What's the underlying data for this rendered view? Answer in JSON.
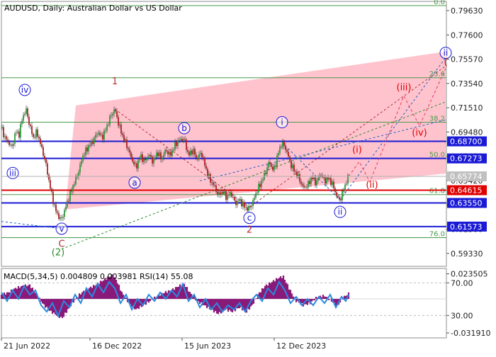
{
  "chart_data": [
    {
      "type": "line",
      "title": "AUDUSD, Daily:  Australian Dollar vs US Dollar",
      "ylim": [
        0.5825,
        0.804
      ],
      "y_ticks": [
        "0.79630",
        "0.77600",
        "0.75570",
        "0.73540",
        "0.71510",
        "0.69480",
        "0.67450",
        "0.65420",
        "0.63390",
        "0.61360",
        "0.59330"
      ],
      "x_ticks": [
        {
          "label": "21 Jun 2022",
          "bar": 0
        },
        {
          "label": "16 Dec 2022",
          "bar": 125
        },
        {
          "label": "15 Jun 2023",
          "bar": 255
        },
        {
          "label": "12 Dec 2023",
          "bar": 385
        }
      ],
      "price_tags": [
        {
          "value": 0.687,
          "label": "0.68700",
          "color": "#1a1ad6"
        },
        {
          "value": 0.67273,
          "label": "0.67273",
          "color": "#1a1ad6"
        },
        {
          "value": 0.65774,
          "label": "0.65774",
          "color": "#c0c0c0"
        },
        {
          "value": 0.64615,
          "label": "0.64615",
          "color": "#e00000"
        },
        {
          "value": 0.6355,
          "label": "0.63550",
          "color": "#1a1ad6"
        },
        {
          "value": 0.61573,
          "label": "0.61573",
          "color": "#1a1ad6"
        }
      ],
      "fib_levels": [
        {
          "label": "0.0",
          "value": 0.8005
        },
        {
          "label": "23.6",
          "value": 0.7402
        },
        {
          "label": "38.2",
          "value": 0.703
        },
        {
          "label": "50.0",
          "value": 0.6727
        },
        {
          "label": "61.8",
          "value": 0.6425
        },
        {
          "label": "76.0",
          "value": 0.6065
        }
      ],
      "wave_labels": [
        {
          "text": "iv",
          "bar": 33,
          "value": 0.73,
          "color": "#1a1ad6",
          "circled": true
        },
        {
          "text": "iii",
          "bar": 16,
          "value": 0.6605,
          "color": "#1a1ad6",
          "circled": true
        },
        {
          "text": "v",
          "bar": 85,
          "value": 0.614,
          "color": "#1a1ad6",
          "circled": true
        },
        {
          "text": "C",
          "bar": 85,
          "value": 0.6012,
          "color": "#b03030",
          "circled": false
        },
        {
          "text": "(2)",
          "bar": 80,
          "value": 0.594,
          "color": "#2a8a2a",
          "circled": false
        },
        {
          "text": "1",
          "bar": 160,
          "value": 0.737,
          "color": "#b03030",
          "circled": false
        },
        {
          "text": "a",
          "bar": 188,
          "value": 0.6525,
          "color": "#1a1ad6",
          "circled": true
        },
        {
          "text": "b",
          "bar": 258,
          "value": 0.698,
          "color": "#1a1ad6",
          "circled": true
        },
        {
          "text": "c",
          "bar": 350,
          "value": 0.623,
          "color": "#1a1ad6",
          "circled": true
        },
        {
          "text": "2",
          "bar": 350,
          "value": 0.613,
          "color": "#b03030",
          "circled": false
        },
        {
          "text": "i",
          "bar": 396,
          "value": 0.703,
          "color": "#1a1ad6",
          "circled": true
        },
        {
          "text": "ii",
          "bar": 478,
          "value": 0.628,
          "color": "#1a1ad6",
          "circled": true
        },
        {
          "text": "(i)",
          "bar": 502,
          "value": 0.68,
          "color": "#e00000",
          "circled": false
        },
        {
          "text": "(ii)",
          "bar": 523,
          "value": 0.6505,
          "color": "#e00000",
          "circled": false
        },
        {
          "text": "(iii)",
          "bar": 568,
          "value": 0.732,
          "color": "#e00000",
          "circled": false
        },
        {
          "text": "(iv)",
          "bar": 590,
          "value": 0.694,
          "color": "#e00000",
          "circled": false
        },
        {
          "text": "ii",
          "bar": 627,
          "value": 0.761,
          "color": "#1a1ad6",
          "circled": true
        },
        {
          "text": "(",
          "bar": 627,
          "value": 0.753,
          "color": "#e00000",
          "circled": false
        }
      ],
      "price_path": [
        [
          0,
          0.698
        ],
        [
          5,
          0.69
        ],
        [
          10,
          0.686
        ],
        [
          15,
          0.682
        ],
        [
          20,
          0.695
        ],
        [
          25,
          0.693
        ],
        [
          30,
          0.708
        ],
        [
          35,
          0.713
        ],
        [
          40,
          0.7
        ],
        [
          45,
          0.69
        ],
        [
          50,
          0.695
        ],
        [
          55,
          0.685
        ],
        [
          62,
          0.67
        ],
        [
          70,
          0.645
        ],
        [
          76,
          0.63
        ],
        [
          80,
          0.625
        ],
        [
          84,
          0.621
        ],
        [
          88,
          0.627
        ],
        [
          94,
          0.638
        ],
        [
          100,
          0.648
        ],
        [
          108,
          0.66
        ],
        [
          115,
          0.675
        ],
        [
          122,
          0.682
        ],
        [
          130,
          0.688
        ],
        [
          136,
          0.695
        ],
        [
          142,
          0.69
        ],
        [
          148,
          0.698
        ],
        [
          154,
          0.708
        ],
        [
          160,
          0.714
        ],
        [
          166,
          0.7
        ],
        [
          172,
          0.69
        ],
        [
          178,
          0.682
        ],
        [
          184,
          0.672
        ],
        [
          190,
          0.665
        ],
        [
          196,
          0.675
        ],
        [
          202,
          0.67
        ],
        [
          208,
          0.676
        ],
        [
          214,
          0.67
        ],
        [
          220,
          0.678
        ],
        [
          226,
          0.672
        ],
        [
          232,
          0.68
        ],
        [
          238,
          0.675
        ],
        [
          244,
          0.683
        ],
        [
          250,
          0.688
        ],
        [
          258,
          0.689
        ],
        [
          264,
          0.675
        ],
        [
          270,
          0.68
        ],
        [
          276,
          0.672
        ],
        [
          282,
          0.678
        ],
        [
          288,
          0.665
        ],
        [
          294,
          0.655
        ],
        [
          300,
          0.65
        ],
        [
          306,
          0.642
        ],
        [
          312,
          0.645
        ],
        [
          318,
          0.64
        ],
        [
          324,
          0.644
        ],
        [
          330,
          0.635
        ],
        [
          336,
          0.638
        ],
        [
          342,
          0.633
        ],
        [
          348,
          0.63
        ],
        [
          354,
          0.635
        ],
        [
          360,
          0.645
        ],
        [
          366,
          0.652
        ],
        [
          372,
          0.66
        ],
        [
          378,
          0.67
        ],
        [
          384,
          0.662
        ],
        [
          390,
          0.676
        ],
        [
          396,
          0.686
        ],
        [
          402,
          0.68
        ],
        [
          408,
          0.668
        ],
        [
          414,
          0.662
        ],
        [
          420,
          0.656
        ],
        [
          426,
          0.648
        ],
        [
          432,
          0.65
        ],
        [
          438,
          0.657
        ],
        [
          444,
          0.652
        ],
        [
          450,
          0.66
        ],
        [
          456,
          0.654
        ],
        [
          462,
          0.656
        ],
        [
          468,
          0.65
        ],
        [
          474,
          0.64
        ],
        [
          478,
          0.638
        ],
        [
          482,
          0.645
        ],
        [
          486,
          0.652
        ],
        [
          490,
          0.6577
        ]
      ],
      "channel": {
        "upper": [
          [
            105,
            0.717
          ],
          [
            627,
            0.762
          ]
        ],
        "lower": [
          [
            90,
            0.63
          ],
          [
            627,
            0.66
          ]
        ]
      },
      "forecast_path": [
        [
          490,
          0.6577
        ],
        [
          505,
          0.67
        ],
        [
          520,
          0.653
        ],
        [
          568,
          0.725
        ],
        [
          590,
          0.7
        ],
        [
          627,
          0.748
        ]
      ],
      "trend_lines": [
        {
          "from": [
            0,
            0.62
          ],
          "to": [
            85,
            0.614
          ],
          "style": "dashed",
          "color": "#2060c0"
        },
        {
          "from": [
            85,
            0.597
          ],
          "to": [
            627,
            0.72
          ],
          "style": "dashed",
          "color": "#2a8a2a"
        },
        {
          "from": [
            160,
            0.714
          ],
          "to": [
            350,
            0.632
          ],
          "style": "dashed",
          "color": "#b03030"
        },
        {
          "from": [
            350,
            0.632
          ],
          "to": [
            627,
            0.75
          ],
          "style": "dashed",
          "color": "#b03030"
        },
        {
          "from": [
            396,
            0.686
          ],
          "to": [
            478,
            0.638
          ],
          "style": "dashed",
          "color": "#2060c0"
        },
        {
          "from": [
            478,
            0.638
          ],
          "to": [
            627,
            0.757
          ],
          "style": "dashed",
          "color": "#2060c0"
        },
        {
          "from": [
            280,
            0.654
          ],
          "to": [
            627,
            0.705
          ],
          "style": "dashed",
          "color": "#2060c0"
        }
      ]
    },
    {
      "type": "area",
      "title": "MACD(5,34,5) 0.004809 0.003981 RSI(14) 55.08",
      "ylim": [
        -0.0365,
        0.0285
      ],
      "y_ticks": [
        "0.023505",
        "70.00",
        "30.00",
        "-0.031910"
      ],
      "levels": [
        {
          "label": "70.00",
          "value": 0.015
        },
        {
          "label": "30.00",
          "value": -0.0155
        }
      ],
      "histogram": [
        [
          0,
          0.004
        ],
        [
          10,
          0.006
        ],
        [
          20,
          0.01
        ],
        [
          30,
          0.012
        ],
        [
          40,
          0.013
        ],
        [
          50,
          0.004
        ],
        [
          60,
          -0.006
        ],
        [
          70,
          -0.012
        ],
        [
          80,
          -0.016
        ],
        [
          86,
          -0.018
        ],
        [
          92,
          -0.012
        ],
        [
          100,
          -0.004
        ],
        [
          110,
          0.004
        ],
        [
          120,
          0.009
        ],
        [
          130,
          0.012
        ],
        [
          140,
          0.016
        ],
        [
          150,
          0.02
        ],
        [
          156,
          0.022
        ],
        [
          162,
          0.018
        ],
        [
          170,
          0.006
        ],
        [
          180,
          -0.004
        ],
        [
          190,
          -0.01
        ],
        [
          200,
          -0.006
        ],
        [
          210,
          -0.002
        ],
        [
          220,
          0.003
        ],
        [
          230,
          0.006
        ],
        [
          240,
          0.008
        ],
        [
          250,
          0.012
        ],
        [
          258,
          0.014
        ],
        [
          266,
          0.006
        ],
        [
          276,
          -0.002
        ],
        [
          286,
          -0.006
        ],
        [
          296,
          -0.01
        ],
        [
          306,
          -0.014
        ],
        [
          316,
          -0.01
        ],
        [
          326,
          -0.012
        ],
        [
          336,
          -0.008
        ],
        [
          346,
          -0.012
        ],
        [
          354,
          -0.006
        ],
        [
          362,
          0.004
        ],
        [
          372,
          0.012
        ],
        [
          382,
          0.016
        ],
        [
          392,
          0.02
        ],
        [
          398,
          0.021
        ],
        [
          406,
          0.01
        ],
        [
          416,
          -0.002
        ],
        [
          426,
          -0.006
        ],
        [
          436,
          -0.004
        ],
        [
          446,
          0.002
        ],
        [
          456,
          0.003
        ],
        [
          466,
          -0.002
        ],
        [
          474,
          -0.007
        ],
        [
          482,
          0.001
        ],
        [
          490,
          0.005
        ]
      ],
      "rsi_line": [
        [
          0,
          0.006
        ],
        [
          8,
          -0.002
        ],
        [
          16,
          0.008
        ],
        [
          24,
          0.0
        ],
        [
          32,
          0.012
        ],
        [
          40,
          0.004
        ],
        [
          48,
          0.008
        ],
        [
          56,
          -0.006
        ],
        [
          64,
          -0.012
        ],
        [
          72,
          -0.004
        ],
        [
          80,
          -0.016
        ],
        [
          88,
          -0.002
        ],
        [
          96,
          -0.008
        ],
        [
          104,
          0.004
        ],
        [
          112,
          -0.004
        ],
        [
          120,
          0.01
        ],
        [
          128,
          0.002
        ],
        [
          136,
          0.014
        ],
        [
          144,
          0.006
        ],
        [
          152,
          0.016
        ],
        [
          160,
          0.01
        ],
        [
          168,
          -0.004
        ],
        [
          176,
          0.004
        ],
        [
          184,
          -0.01
        ],
        [
          192,
          0.0
        ],
        [
          200,
          -0.006
        ],
        [
          208,
          0.004
        ],
        [
          216,
          -0.002
        ],
        [
          224,
          0.006
        ],
        [
          232,
          0.0
        ],
        [
          240,
          0.008
        ],
        [
          248,
          0.002
        ],
        [
          256,
          0.014
        ],
        [
          264,
          -0.002
        ],
        [
          272,
          0.004
        ],
        [
          280,
          -0.008
        ],
        [
          288,
          0.0
        ],
        [
          296,
          -0.01
        ],
        [
          304,
          -0.004
        ],
        [
          312,
          -0.012
        ],
        [
          320,
          -0.006
        ],
        [
          328,
          -0.01
        ],
        [
          336,
          -0.004
        ],
        [
          344,
          -0.012
        ],
        [
          352,
          -0.002
        ],
        [
          360,
          0.004
        ],
        [
          368,
          -0.002
        ],
        [
          376,
          0.01
        ],
        [
          384,
          0.004
        ],
        [
          392,
          0.016
        ],
        [
          400,
          0.008
        ],
        [
          408,
          -0.004
        ],
        [
          416,
          0.002
        ],
        [
          424,
          -0.006
        ],
        [
          432,
          0.0
        ],
        [
          440,
          -0.006
        ],
        [
          448,
          0.002
        ],
        [
          456,
          -0.004
        ],
        [
          464,
          0.004
        ],
        [
          472,
          -0.008
        ],
        [
          480,
          0.002
        ],
        [
          486,
          -0.002
        ],
        [
          490,
          0.004
        ]
      ]
    }
  ]
}
